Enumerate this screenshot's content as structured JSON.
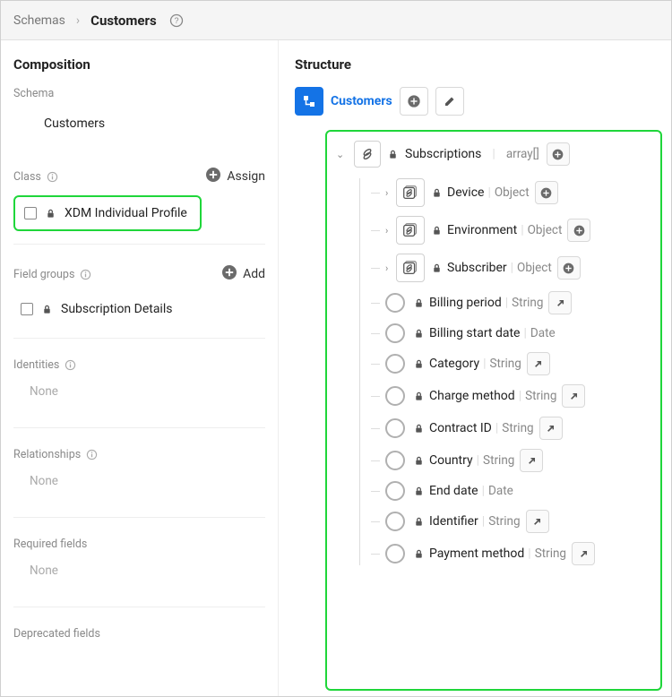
{
  "breadcrumb": {
    "parent": "Schemas",
    "current": "Customers"
  },
  "left": {
    "title": "Composition",
    "schema_label": "Schema",
    "schema_name": "Customers",
    "class_label": "Class",
    "assign_label": "Assign",
    "class_item": "XDM Individual Profile",
    "fg_label": "Field groups",
    "add_label": "Add",
    "fg_item": "Subscription Details",
    "identities_label": "Identities",
    "relationships_label": "Relationships",
    "required_label": "Required fields",
    "deprecated_label": "Deprecated fields",
    "none": "None"
  },
  "right": {
    "title": "Structure",
    "root_link": "Customers",
    "subscriptions": {
      "name": "Subscriptions",
      "type": "array[]"
    },
    "object_children": [
      {
        "name": "Device",
        "type": "Object"
      },
      {
        "name": "Environment",
        "type": "Object"
      },
      {
        "name": "Subscriber",
        "type": "Object"
      }
    ],
    "fields": [
      {
        "name": "Billing period",
        "type": "String",
        "arrow": true
      },
      {
        "name": "Billing start date",
        "type": "Date"
      },
      {
        "name": "Category",
        "type": "String",
        "arrow": true
      },
      {
        "name": "Charge method",
        "type": "String",
        "arrow": true
      },
      {
        "name": "Contract ID",
        "type": "String",
        "arrow": true
      },
      {
        "name": "Country",
        "type": "String",
        "arrow": true
      },
      {
        "name": "End date",
        "type": "Date"
      },
      {
        "name": "Identifier",
        "type": "String",
        "arrow": true
      },
      {
        "name": "Payment method",
        "type": "String",
        "arrow": true
      }
    ]
  }
}
